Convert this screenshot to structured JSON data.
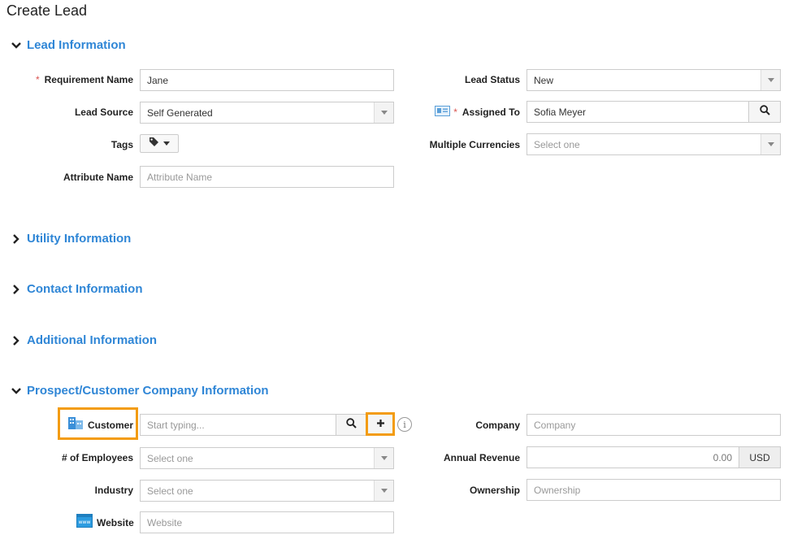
{
  "page": {
    "title": "Create Lead"
  },
  "sections": {
    "lead_information": "Lead Information",
    "utility_information": "Utility Information",
    "contact_information": "Contact Information",
    "additional_information": "Additional Information",
    "prospect_company": "Prospect/Customer Company Information"
  },
  "lead": {
    "requirement_name": {
      "label": "Requirement Name",
      "value": "Jane",
      "required": true
    },
    "lead_source": {
      "label": "Lead Source",
      "value": "Self Generated"
    },
    "tags": {
      "label": "Tags",
      "icon": "tag-icon"
    },
    "attribute_name": {
      "label": "Attribute Name",
      "placeholder": "Attribute Name"
    },
    "lead_status": {
      "label": "Lead Status",
      "value": "New"
    },
    "assigned_to": {
      "label": "Assigned To",
      "value": "Sofia Meyer",
      "required": true,
      "icon": "contact-card-icon"
    },
    "multiple_currencies": {
      "label": "Multiple Currencies",
      "placeholder": "Select one"
    }
  },
  "company": {
    "customer": {
      "label": "Customer",
      "placeholder": "Start typing...",
      "icon": "building-icon"
    },
    "employees": {
      "label": "# of Employees",
      "placeholder": "Select one"
    },
    "industry": {
      "label": "Industry",
      "placeholder": "Select one"
    },
    "website": {
      "label": "Website",
      "placeholder": "Website",
      "icon": "www-icon"
    },
    "company": {
      "label": "Company",
      "placeholder": "Company"
    },
    "annual_revenue": {
      "label": "Annual Revenue",
      "value": "0.00",
      "currency": "USD"
    },
    "ownership": {
      "label": "Ownership",
      "placeholder": "Ownership"
    }
  },
  "colors": {
    "accent": "#2f86d6",
    "highlight": "#f39c12",
    "required": "#d9534f"
  }
}
